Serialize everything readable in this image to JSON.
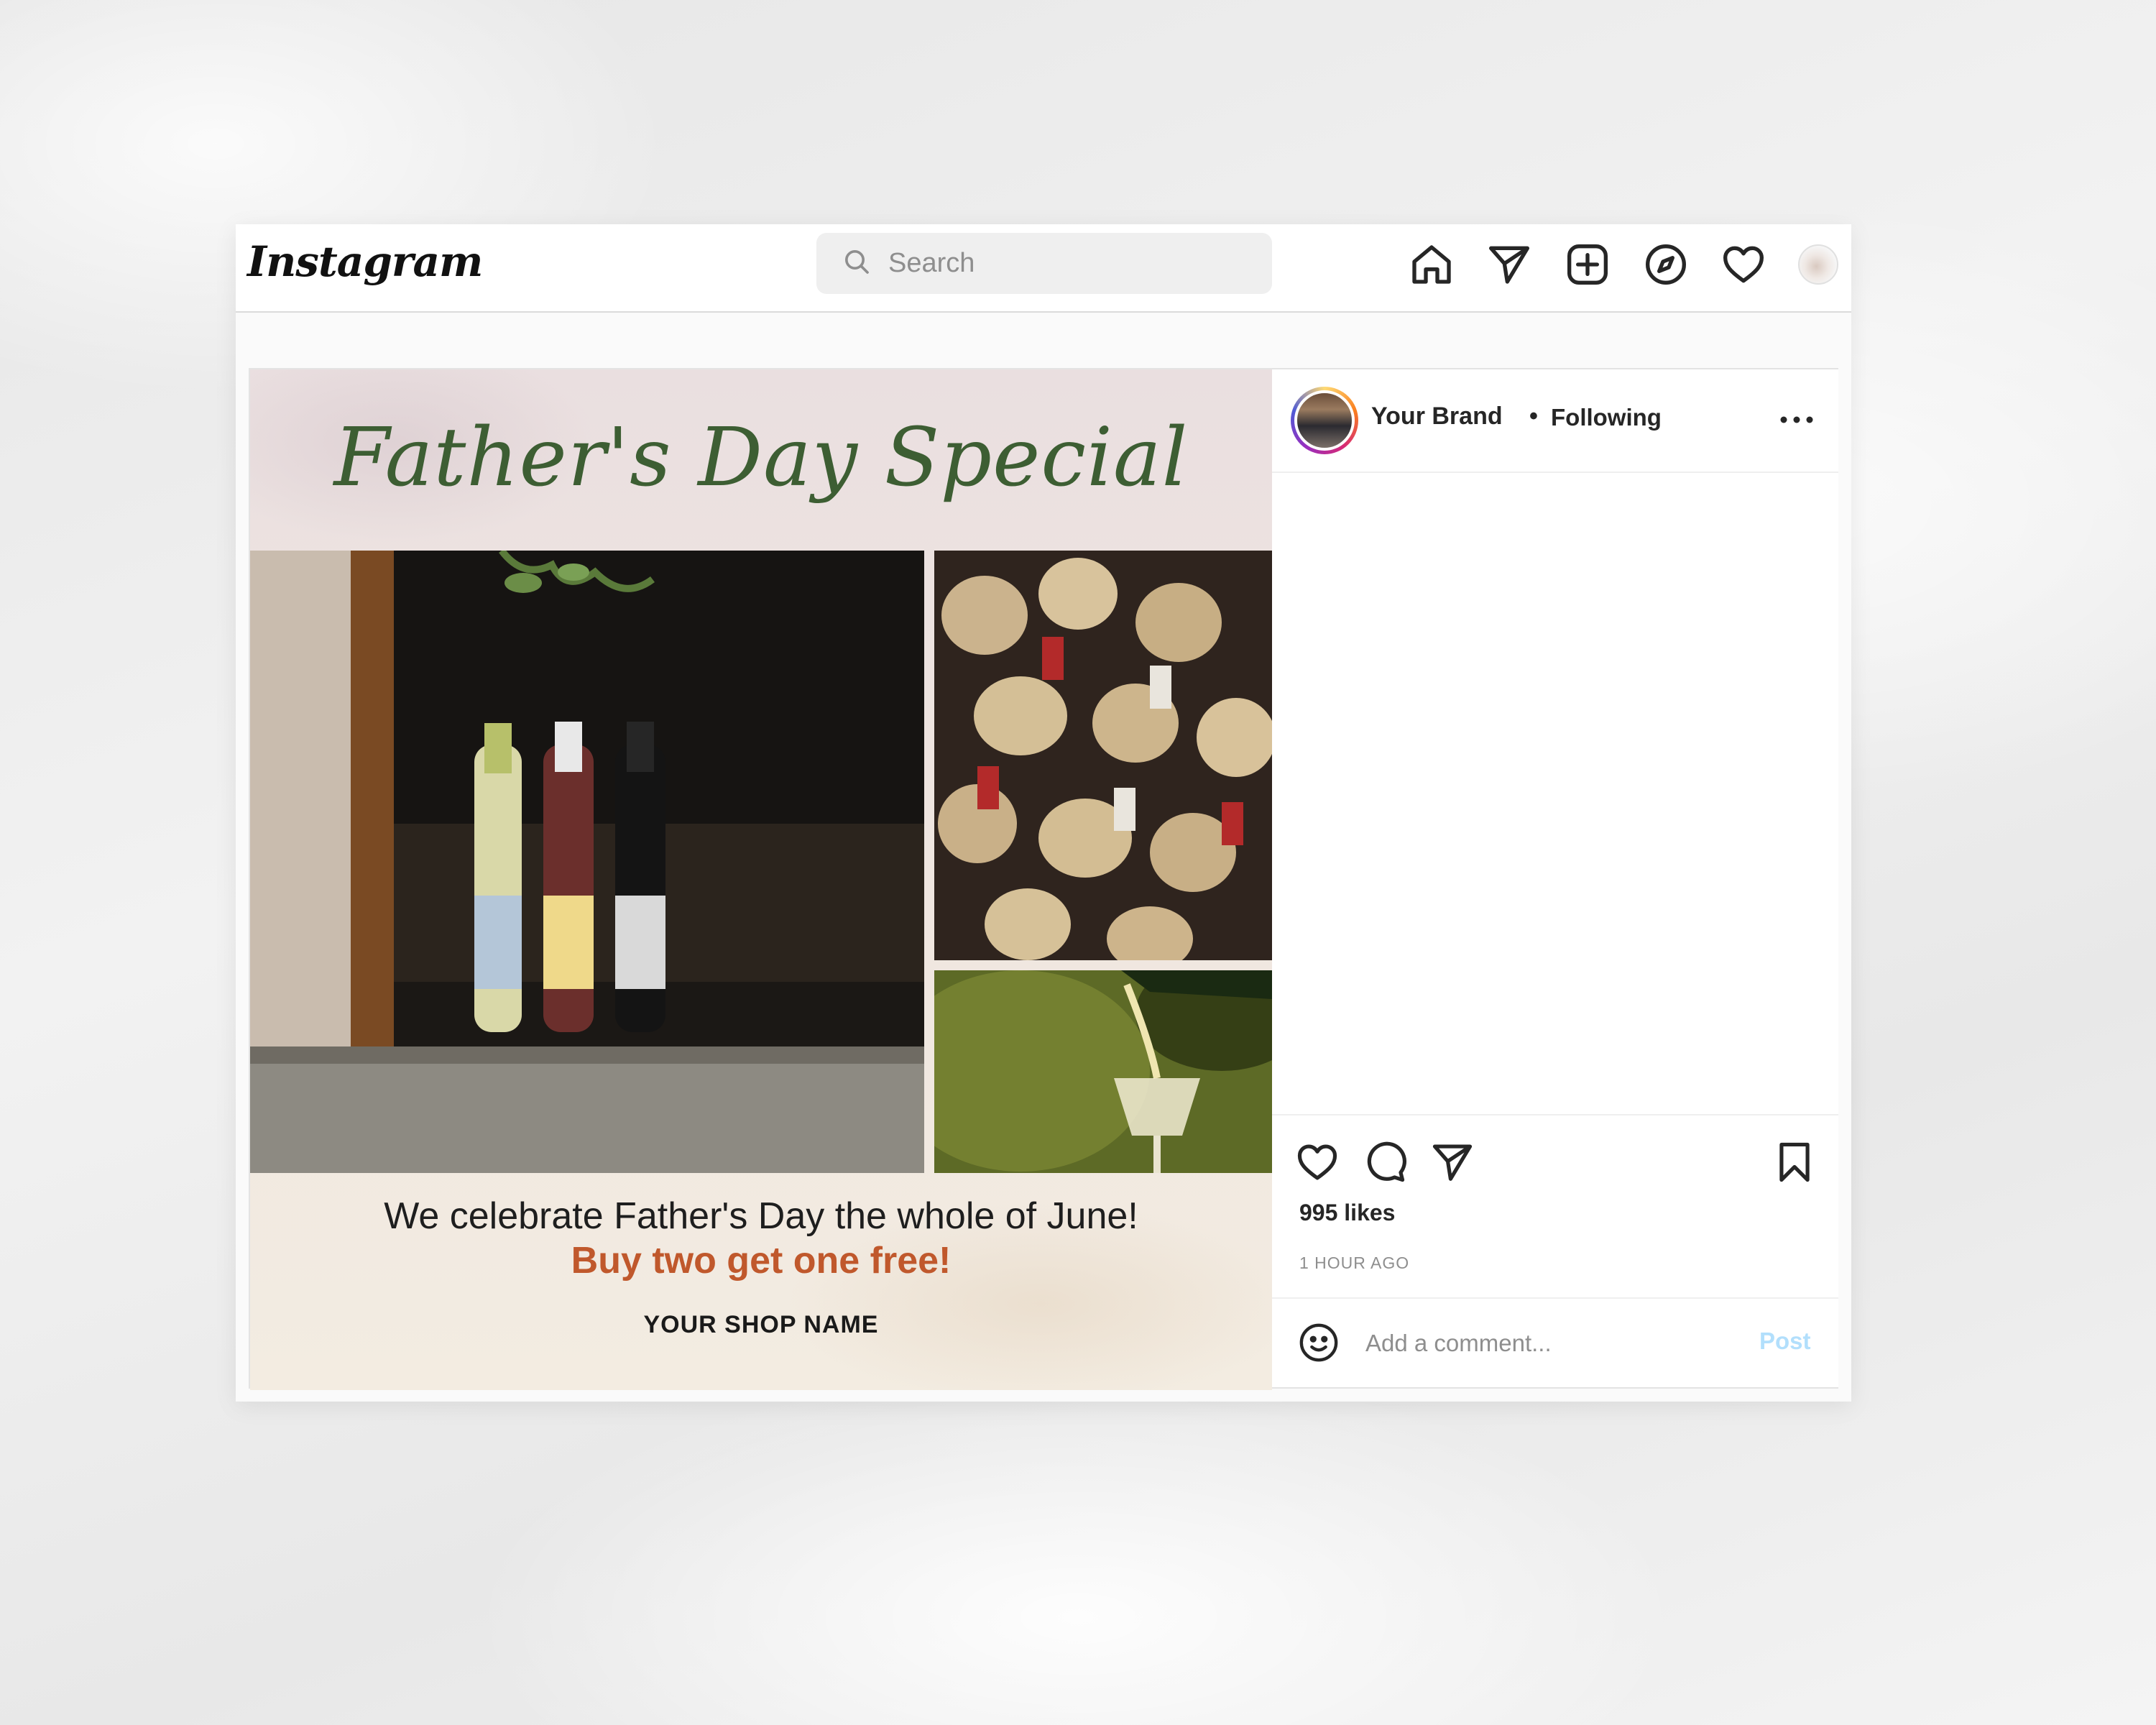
{
  "app": {
    "logo_text": "Instagram"
  },
  "search": {
    "placeholder": "Search"
  },
  "nav": {
    "icons": [
      "home-icon",
      "direct-send-icon",
      "new-post-icon",
      "explore-compass-icon",
      "activity-heart-icon",
      "profile-avatar"
    ]
  },
  "post": {
    "author": "Your Brand",
    "separator": "•",
    "follow_status": "Following",
    "likes": "995 likes",
    "time_ago": "1 HOUR AGO",
    "comment_placeholder": "Add a comment...",
    "post_button": "Post",
    "creative": {
      "title": "Father's Day Special",
      "line1": "We celebrate Father's Day the whole of June!",
      "line2": "Buy two get one free!",
      "shop_name": "YOUR SHOP NAME"
    }
  },
  "colors": {
    "title_green": "#3d5e33",
    "offer_orange": "#c0582c",
    "post_button_disabled": "#b2dffc"
  }
}
